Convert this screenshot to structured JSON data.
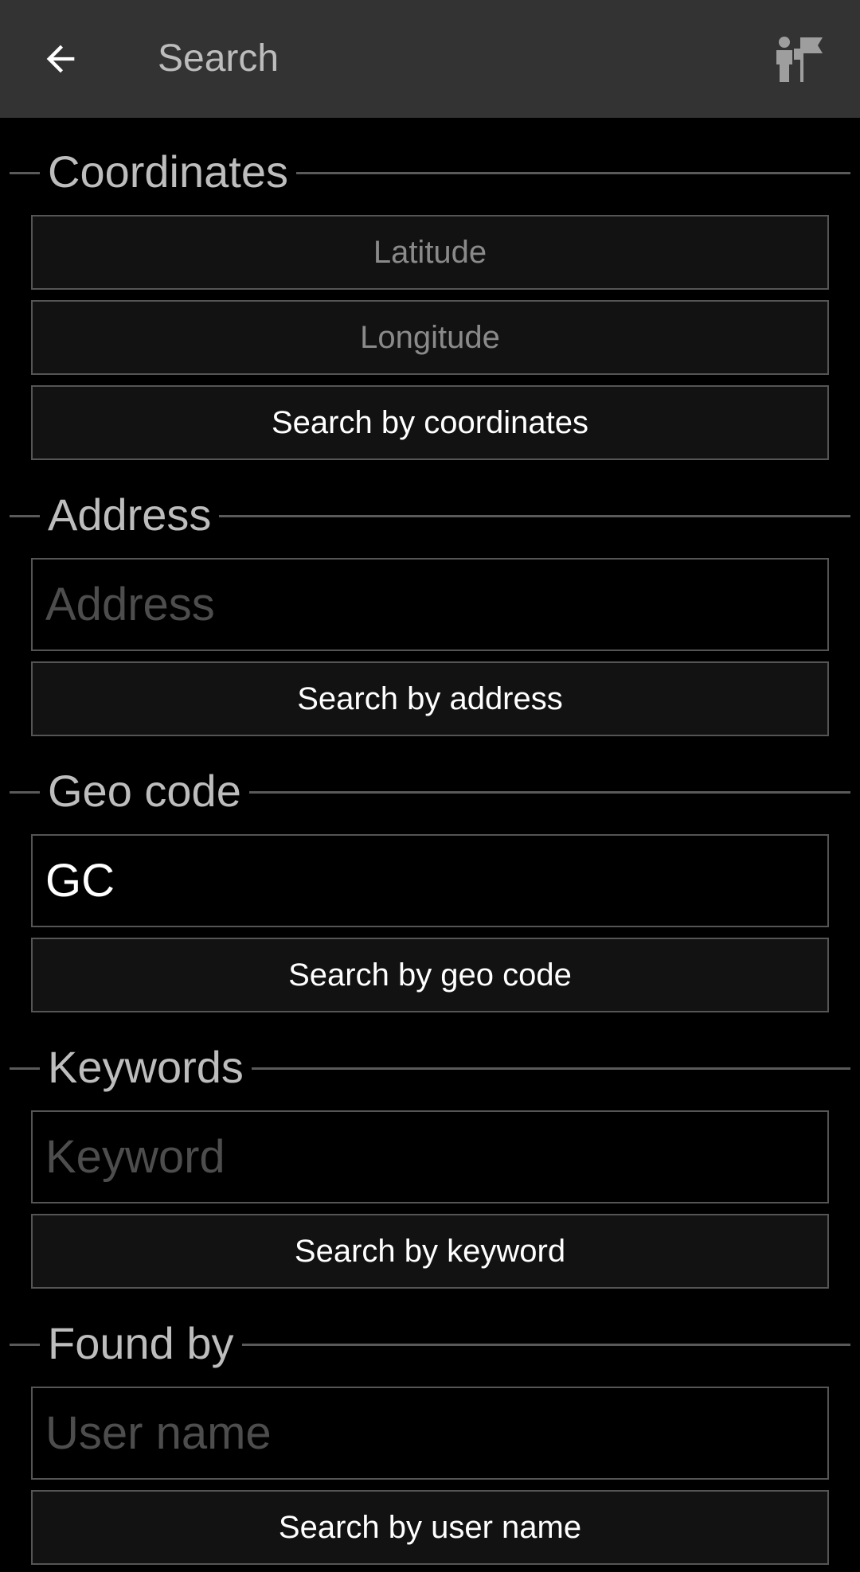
{
  "toolbar": {
    "title": "Search",
    "back_icon": "arrow-left-icon",
    "action_icon": "person-with-flag-icon"
  },
  "sections": {
    "coordinates": {
      "title": "Coordinates",
      "latitude_label": "Latitude",
      "longitude_label": "Longitude",
      "button": "Search by coordinates"
    },
    "address": {
      "title": "Address",
      "placeholder": "Address",
      "value": "",
      "button": "Search by address"
    },
    "geocode": {
      "title": "Geo code",
      "value": "GC",
      "button": "Search by geo code"
    },
    "keywords": {
      "title": "Keywords",
      "placeholder": "Keyword",
      "value": "",
      "button": "Search by keyword"
    },
    "found_by": {
      "title": "Found by",
      "placeholder": "User name",
      "value": "",
      "button": "Search by user name"
    }
  }
}
